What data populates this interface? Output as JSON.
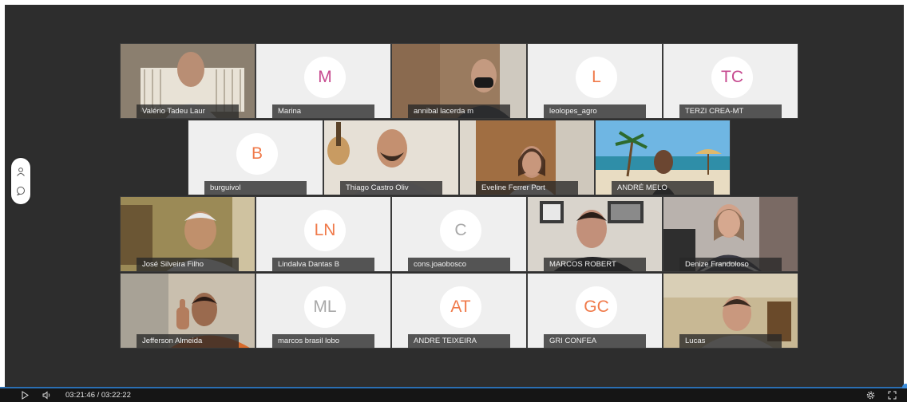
{
  "player": {
    "current_time": "03:21:46",
    "duration": "03:22:22",
    "time_display": "03:21:46 / 03:22:22",
    "progress_fraction": 0.997
  },
  "accent_color": "#f07a4a",
  "participants": {
    "row1": [
      {
        "name": "Valério Tadeu Laur",
        "type": "video"
      },
      {
        "name": "Marina",
        "type": "avatar",
        "initials": "M",
        "color": "#c6498f"
      },
      {
        "name": "annibal lacerda m",
        "type": "video"
      },
      {
        "name": "leolopes_agro",
        "type": "avatar",
        "initials": "L",
        "color": "#f07a4a"
      },
      {
        "name": "TERZI CREA-MT",
        "type": "avatar",
        "initials": "TC",
        "color": "#c6498f"
      }
    ],
    "row2": [
      {
        "name": "burguivol",
        "type": "avatar",
        "initials": "B",
        "color": "#f07a4a"
      },
      {
        "name": "Thiago Castro Oliv",
        "type": "video"
      },
      {
        "name": "Eveline Ferrer Port",
        "type": "video"
      },
      {
        "name": "ANDRÉ MELO",
        "type": "video"
      }
    ],
    "row3": [
      {
        "name": "José Silveira Filho",
        "type": "video"
      },
      {
        "name": "Lindalva Dantas B",
        "type": "avatar",
        "initials": "LN",
        "color": "#f07a4a"
      },
      {
        "name": "cons.joaobosco",
        "type": "avatar",
        "initials": "C",
        "color": "#a8a8a8"
      },
      {
        "name": "MARCOS ROBERT",
        "type": "video"
      },
      {
        "name": "Denize Frandoloso",
        "type": "video"
      }
    ],
    "row4": [
      {
        "name": "Jefferson Almeida",
        "type": "video"
      },
      {
        "name": "marcos brasil lobo",
        "type": "avatar",
        "initials": "ML",
        "color": "#a8a8a8"
      },
      {
        "name": "ANDRE TEIXEIRA",
        "type": "avatar",
        "initials": "AT",
        "color": "#f07a4a"
      },
      {
        "name": "GRI CONFEA",
        "type": "avatar",
        "initials": "GC",
        "color": "#f07a4a"
      },
      {
        "name": "Lucas",
        "type": "video"
      }
    ]
  },
  "icons": {
    "side": [
      "user-icon",
      "chat-icon"
    ],
    "controls_left": [
      "play-icon",
      "volume-icon"
    ],
    "controls_right": [
      "settings-icon",
      "fullscreen-icon"
    ]
  }
}
